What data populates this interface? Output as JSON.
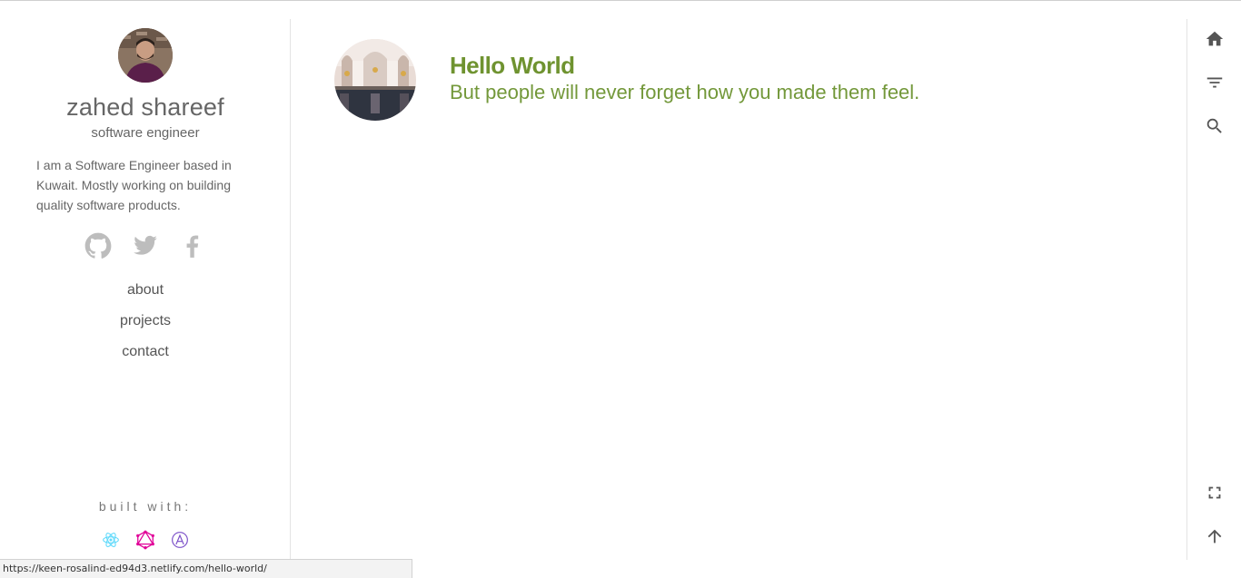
{
  "profile": {
    "name": "zahed shareef",
    "role": "software engineer",
    "bio": "I am a Software Engineer based in Kuwait. Mostly working on building quality software products."
  },
  "social": {
    "items": [
      {
        "icon": "github-icon"
      },
      {
        "icon": "twitter-icon"
      },
      {
        "icon": "facebook-icon"
      }
    ],
    "color": "#bdbdbd"
  },
  "nav": {
    "items": [
      {
        "label": "about"
      },
      {
        "label": "projects"
      },
      {
        "label": "contact"
      }
    ]
  },
  "built_with": {
    "label": "built with:",
    "icons": [
      {
        "icon": "react-icon",
        "color": "#61dafb"
      },
      {
        "icon": "graphql-icon",
        "color": "#e10098"
      },
      {
        "icon": "apollo-icon",
        "color": "#7b4fc8"
      }
    ]
  },
  "posts": [
    {
      "title": "Hello World",
      "excerpt": "But people will never forget how you made them feel."
    }
  ],
  "accent_color": "#6f9330",
  "rail": {
    "top": [
      {
        "icon": "home-icon"
      },
      {
        "icon": "filter-icon"
      },
      {
        "icon": "search-icon"
      }
    ],
    "bottom": [
      {
        "icon": "fullscreen-icon"
      },
      {
        "icon": "arrow-up-icon"
      }
    ]
  },
  "status": {
    "url": "https://keen-rosalind-ed94d3.netlify.com/hello-world/"
  }
}
